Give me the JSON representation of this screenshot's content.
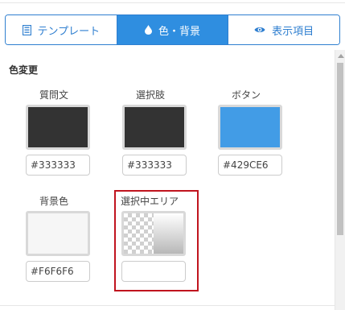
{
  "tabs": [
    {
      "label": "テンプレート",
      "icon": "template-icon",
      "active": false
    },
    {
      "label": "色・背景",
      "icon": "drop-icon",
      "active": true
    },
    {
      "label": "表示項目",
      "icon": "eye-icon",
      "active": false
    }
  ],
  "section": {
    "title": "色変更"
  },
  "fields": {
    "question": {
      "label": "質問文",
      "color": "#333333",
      "value": "#333333"
    },
    "choice": {
      "label": "選択肢",
      "color": "#333333",
      "value": "#333333"
    },
    "button": {
      "label": "ボタン",
      "color": "#429CE6",
      "value": "#429CE6"
    },
    "background": {
      "label": "背景色",
      "color": "#F6F6F6",
      "value": "#F6F6F6"
    },
    "selected_area": {
      "label": "選択中エリア",
      "value": ""
    }
  },
  "colors": {
    "accent": "#2f8ee0",
    "highlight_border": "#c0141e"
  }
}
